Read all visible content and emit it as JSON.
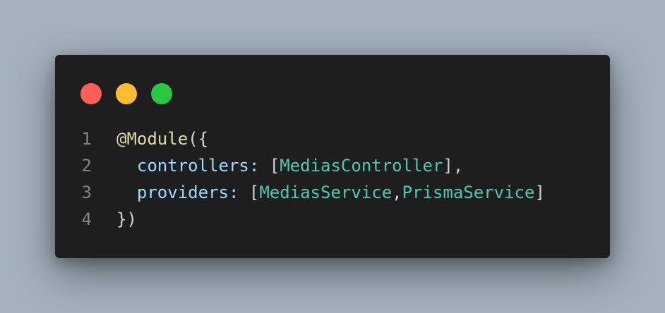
{
  "colors": {
    "background": "#a5b1bd",
    "window": "#1e1e1e",
    "close_dot": "#ff5f57",
    "minimize_dot": "#febc2e",
    "maximize_dot": "#28c840"
  },
  "code": {
    "line_numbers": [
      "1",
      "2",
      "3",
      "4"
    ],
    "line1": {
      "decorator": "@Module",
      "open": "({"
    },
    "line2": {
      "indent": "  ",
      "key": "controllers",
      "colon": ": ",
      "open_bracket": "[",
      "class": "MediasController",
      "close": "],"
    },
    "line3": {
      "indent": "  ",
      "key": "providers",
      "colon": ": ",
      "open_bracket": "[",
      "class1": "MediasService",
      "comma": ",",
      "class2": "PrismaService",
      "close": "]"
    },
    "line4": {
      "close": "})"
    }
  }
}
